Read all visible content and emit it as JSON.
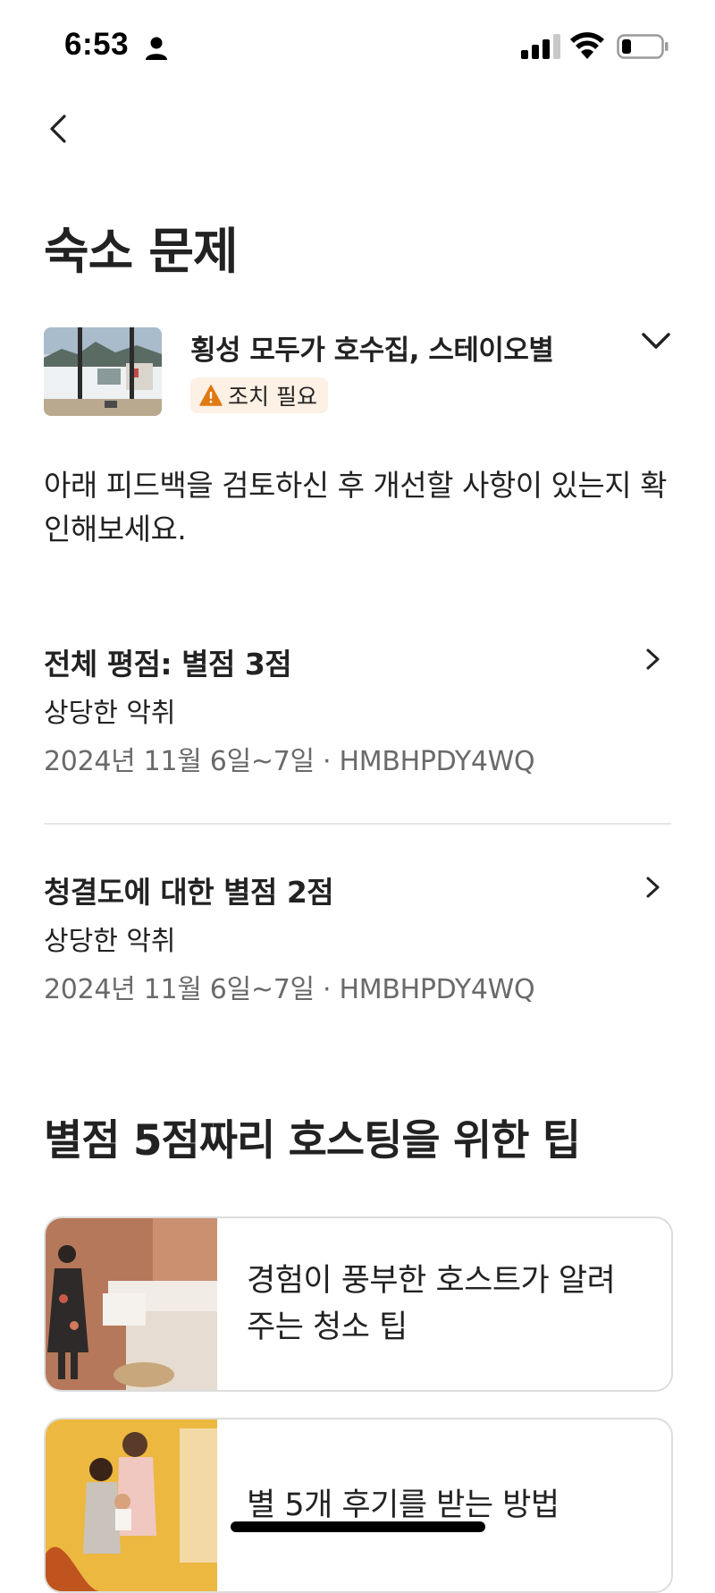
{
  "status_bar": {
    "time": "6:53"
  },
  "page": {
    "title": "숙소 문제"
  },
  "listing": {
    "name": "횡성 모두가 호수집, 스테이오별",
    "badge": "조치 필요"
  },
  "intro": "아래 피드백을 검토하신 후 개선할 사항이 있는지 확인해보세요.",
  "issues": [
    {
      "title": "전체 평점: 별점 3점",
      "subtitle": "상당한 악취",
      "meta": "2024년 11월 6일~7일 · HMBHPDY4WQ"
    },
    {
      "title": "청결도에 대한 별점 2점",
      "subtitle": "상당한 악취",
      "meta": "2024년 11월 6일~7일 · HMBHPDY4WQ"
    }
  ],
  "tips": {
    "heading": "별점 5점짜리 호스팅을 위한 팁",
    "cards": [
      {
        "title": "경험이 풍부한 호스트가 알려주는 청소 팁"
      },
      {
        "title": "별 5개 후기를 받는 방법"
      }
    ]
  },
  "colors": {
    "text": "#222222",
    "muted": "#6a6a6a",
    "badge_bg": "#fdf0e4",
    "warning": "#e07912",
    "divider": "#e6e6e6",
    "card_border": "#dddddd"
  }
}
